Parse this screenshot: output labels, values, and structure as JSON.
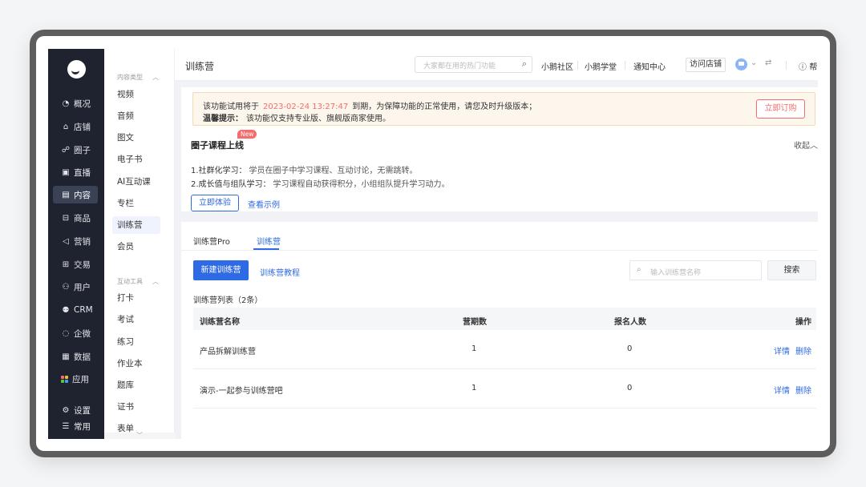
{
  "left_nav": {
    "items": [
      {
        "icon": "overview-icon",
        "glyph": "◔",
        "label": "概况"
      },
      {
        "icon": "shop-icon",
        "glyph": "⌂",
        "label": "店铺"
      },
      {
        "icon": "circle-icon",
        "glyph": "☍",
        "label": "圈子"
      },
      {
        "icon": "live-icon",
        "glyph": "▣",
        "label": "直播"
      },
      {
        "icon": "content-icon",
        "glyph": "▤",
        "label": "内容",
        "active": true
      },
      {
        "icon": "goods-icon",
        "glyph": "⊟",
        "label": "商品"
      },
      {
        "icon": "marketing-icon",
        "glyph": "◁",
        "label": "营销"
      },
      {
        "icon": "trade-icon",
        "glyph": "⊞",
        "label": "交易"
      },
      {
        "icon": "user-icon",
        "glyph": "⚇",
        "label": "用户"
      },
      {
        "icon": "crm-icon",
        "glyph": "⚉",
        "label": "CRM"
      },
      {
        "icon": "enterprise-wechat-icon",
        "glyph": "◌",
        "label": "企微"
      },
      {
        "icon": "data-icon",
        "glyph": "▦",
        "label": "数据"
      },
      {
        "icon": "apps-icon",
        "glyph": "",
        "label": "应用"
      },
      {
        "icon": "settings-icon",
        "glyph": "⚙",
        "label": "设置"
      },
      {
        "icon": "common-icon",
        "glyph": "☰",
        "label": "常用"
      }
    ]
  },
  "sub_nav": {
    "group1": "内容类型",
    "group1_items": [
      "视频",
      "音频",
      "图文",
      "电子书",
      "AI互动课",
      "专栏",
      "训练营",
      "会员"
    ],
    "group2": "互动工具",
    "group2_items": [
      "打卡",
      "考试",
      "练习",
      "作业本",
      "题库",
      "证书",
      "表单"
    ]
  },
  "topbar": {
    "title": "训练营",
    "search_placeholder": "大家都在用的热门功能",
    "links": [
      "小鹅社区",
      "小鹅学堂",
      "通知中心"
    ],
    "visit_store": "访问店铺",
    "help": "帮"
  },
  "notice": {
    "line1_prefix": "该功能试用将于",
    "date": "2023-02-24 13:27:47",
    "line1_suffix": "到期，为保障功能的正常使用，请您及时升级版本；",
    "tip_label": "温馨提示：",
    "tip_text": "该功能仅支持专业版、旗舰版商家使用。",
    "subscribe": "立即订购"
  },
  "promo": {
    "title": "圈子课程上线",
    "badge": "New",
    "collapse": "收起",
    "line1_key": "1.社群化学习：",
    "line1_val": "学员在圈子中学习课程、互动讨论，无需跳转。",
    "line2_key": "2.成长值与组队学习：",
    "line2_val": "学习课程自动获得积分，小组组队提升学习动力。",
    "try_button": "立即体验",
    "example_link": "查看示例"
  },
  "tabs": [
    "训练营Pro",
    "训练营"
  ],
  "toolbar": {
    "new_button": "新建训练营",
    "tutorial_link": "训练营教程",
    "search_placeholder": "输入训练营名称",
    "search_button": "搜索"
  },
  "table": {
    "count_label": "训练营列表（2条）",
    "headers": [
      "训练营名称",
      "营期数",
      "报名人数",
      "操作"
    ],
    "rows": [
      {
        "name": "产品拆解训练营",
        "periods": "1",
        "signups": "0",
        "detail": "详情",
        "delete": "删除"
      },
      {
        "name": "演示-一起参与训练营吧",
        "periods": "1",
        "signups": "0",
        "detail": "详情",
        "delete": "删除"
      }
    ]
  },
  "colors": {
    "primary": "#2d6ae3",
    "danger": "#f56c6c",
    "nav_bg": "#1f2330"
  }
}
